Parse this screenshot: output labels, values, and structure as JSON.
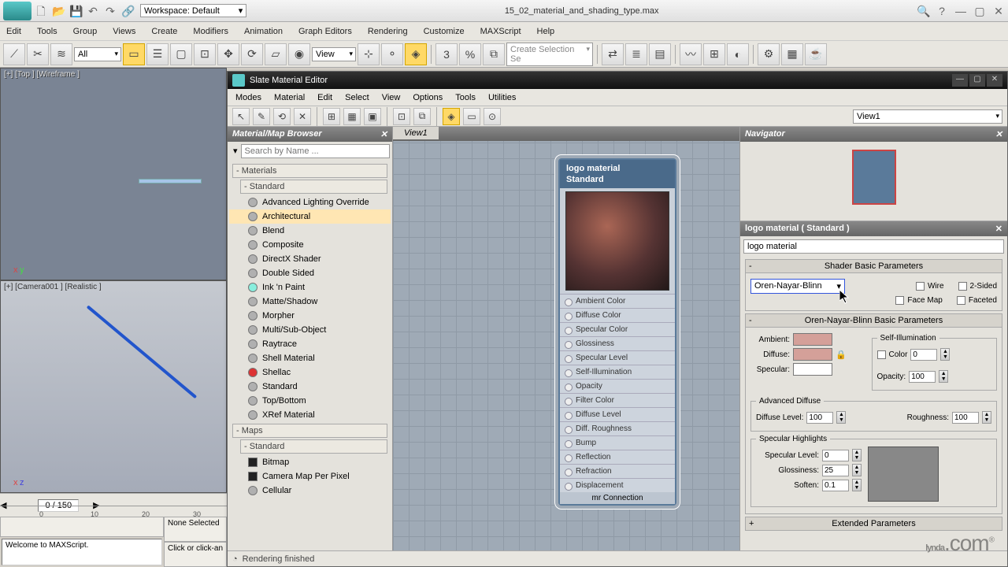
{
  "app": {
    "title": "15_02_material_and_shading_type.max",
    "workspace_label": "Workspace: Default"
  },
  "menu": [
    "Edit",
    "Tools",
    "Group",
    "Views",
    "Create",
    "Modifiers",
    "Animation",
    "Graph Editors",
    "Rendering",
    "Customize",
    "MAXScript",
    "Help"
  ],
  "toolbar": {
    "all_label": "All",
    "view_label": "View",
    "selset_placeholder": "Create Selection Se"
  },
  "viewports": {
    "top_label": "[+] [Top ] [Wireframe ]",
    "cam_label": "[+] [Camera001 ] [Realistic ]",
    "axis_top": "x",
    "axis_top2": "y",
    "axis_bot": "x",
    "axis_bot2": "z"
  },
  "timeline": {
    "frame_label": "0 / 150",
    "ticks": [
      "0",
      "10",
      "20",
      "30"
    ]
  },
  "status": {
    "none_selected": "None Selected",
    "welcome": "Welcome to MAXScript.",
    "click_prompt": "Click or click-an"
  },
  "slate": {
    "title": "Slate Material Editor",
    "menu": [
      "Modes",
      "Material",
      "Edit",
      "Select",
      "View",
      "Options",
      "Tools",
      "Utilities"
    ],
    "view_dropdown": "View1",
    "browser_title": "Material/Map Browser",
    "search_placeholder": "Search by Name ...",
    "sections": {
      "materials": "Materials",
      "standard": "Standard",
      "maps": "Maps"
    },
    "materials": [
      "Advanced Lighting Override",
      "Architectural",
      "Blend",
      "Composite",
      "DirectX Shader",
      "Double Sided",
      "Ink 'n Paint",
      "Matte/Shadow",
      "Morpher",
      "Multi/Sub-Object",
      "Raytrace",
      "Shell Material",
      "Shellac",
      "Standard",
      "Top/Bottom",
      "XRef Material"
    ],
    "maps": [
      "Bitmap",
      "Camera Map Per Pixel",
      "Cellular"
    ],
    "canvas_tab": "View1",
    "node": {
      "name": "logo material",
      "type": "Standard",
      "slots": [
        "Ambient Color",
        "Diffuse Color",
        "Specular Color",
        "Glossiness",
        "Specular Level",
        "Self-Illumination",
        "Opacity",
        "Filter Color",
        "Diffuse Level",
        "Diff. Roughness",
        "Bump",
        "Reflection",
        "Refraction",
        "Displacement"
      ],
      "footer": "mr Connection"
    },
    "navigator_title": "Navigator",
    "params": {
      "title": "logo material  ( Standard )",
      "name_value": "logo material",
      "rollout_shader": "Shader Basic Parameters",
      "shader_type": "Oren-Nayar-Blinn",
      "wire": "Wire",
      "twosided": "2-Sided",
      "facemap": "Face Map",
      "faceted": "Faceted",
      "rollout_onb": "Oren-Nayar-Blinn Basic Parameters",
      "ambient": "Ambient:",
      "diffuse": "Diffuse:",
      "specular": "Specular:",
      "selfillum": "Self-Illumination",
      "color_lbl": "Color",
      "color_val": "0",
      "opacity_lbl": "Opacity:",
      "opacity_val": "100",
      "adv_diffuse": "Advanced Diffuse",
      "diffuse_level": "Diffuse Level:",
      "diffuse_level_val": "100",
      "roughness": "Roughness:",
      "roughness_val": "100",
      "spec_high": "Specular Highlights",
      "spec_level": "Specular Level:",
      "spec_level_val": "0",
      "gloss": "Glossiness:",
      "gloss_val": "25",
      "soften": "Soften:",
      "soften_val": "0.1",
      "extended": "Extended Parameters"
    },
    "status": "Rendering finished"
  },
  "watermark": "lynda.com"
}
